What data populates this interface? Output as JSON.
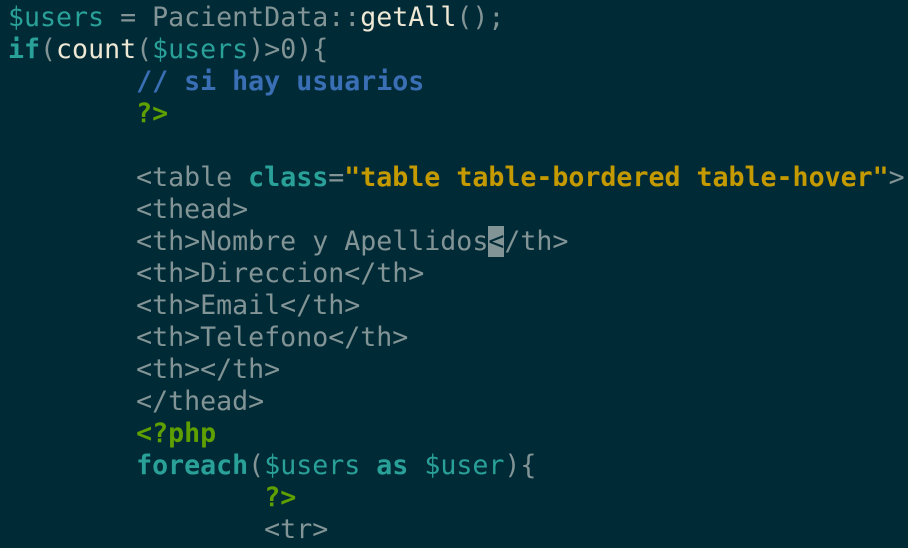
{
  "editor": {
    "theme_colors": {
      "background": "#002b36",
      "text": "#839496",
      "variable": "#2aa198",
      "comment": "#3a6fb5",
      "php_tag": "#5f9f00",
      "string": "#c59a00"
    },
    "cursor": {
      "line": 7,
      "column": 30
    },
    "lines": [
      [
        {
          "t": "$users",
          "c": "v"
        },
        {
          "t": " = PacientData::",
          "c": "n"
        },
        {
          "t": "getAll",
          "c": "f"
        },
        {
          "t": "();",
          "c": "n"
        }
      ],
      [
        {
          "t": "if",
          "c": "k"
        },
        {
          "t": "(",
          "c": "n"
        },
        {
          "t": "count",
          "c": "f"
        },
        {
          "t": "(",
          "c": "n"
        },
        {
          "t": "$users",
          "c": "v"
        },
        {
          "t": ")>0){",
          "c": "n"
        }
      ],
      [
        {
          "t": "        ",
          "c": "n"
        },
        {
          "t": "// si hay usuarios",
          "c": "c"
        }
      ],
      [
        {
          "t": "        ",
          "c": "n"
        },
        {
          "t": "?>",
          "c": "p"
        }
      ],
      [],
      [
        {
          "t": "        <table ",
          "c": "n"
        },
        {
          "t": "class",
          "c": "k"
        },
        {
          "t": "=",
          "c": "n"
        },
        {
          "t": "\"table table-bordered table-hover\"",
          "c": "s"
        },
        {
          "t": ">",
          "c": "n"
        }
      ],
      [
        {
          "t": "        <thead>",
          "c": "n"
        }
      ],
      [
        {
          "t": "        <th>Nombre y Apellidos",
          "c": "n"
        },
        {
          "t": "<",
          "c": "cur"
        },
        {
          "t": "/th>",
          "c": "n"
        }
      ],
      [
        {
          "t": "        <th>Direccion</th>",
          "c": "n"
        }
      ],
      [
        {
          "t": "        <th>Email</th>",
          "c": "n"
        }
      ],
      [
        {
          "t": "        <th>Telefono</th>",
          "c": "n"
        }
      ],
      [
        {
          "t": "        <th></th>",
          "c": "n"
        }
      ],
      [
        {
          "t": "        </thead>",
          "c": "n"
        }
      ],
      [
        {
          "t": "        ",
          "c": "n"
        },
        {
          "t": "<?php",
          "c": "p"
        }
      ],
      [
        {
          "t": "        ",
          "c": "n"
        },
        {
          "t": "foreach",
          "c": "k"
        },
        {
          "t": "(",
          "c": "n"
        },
        {
          "t": "$users",
          "c": "v"
        },
        {
          "t": " ",
          "c": "n"
        },
        {
          "t": "as",
          "c": "k"
        },
        {
          "t": " ",
          "c": "n"
        },
        {
          "t": "$user",
          "c": "v"
        },
        {
          "t": "){",
          "c": "n"
        }
      ],
      [
        {
          "t": "                ",
          "c": "n"
        },
        {
          "t": "?>",
          "c": "p"
        }
      ],
      [
        {
          "t": "                <tr>",
          "c": "n"
        }
      ]
    ]
  }
}
